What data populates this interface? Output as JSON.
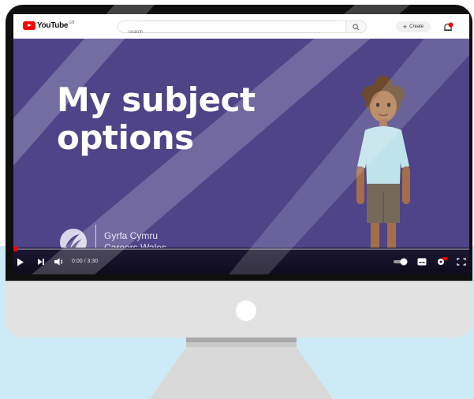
{
  "youtube": {
    "logo_text": "YouTube",
    "region_badge": "GB",
    "search_placeholder": "Search",
    "create_label": "Create"
  },
  "video": {
    "title_line1": "My subject",
    "title_line2": "options",
    "brand_line1": "Gyrfa Cymru",
    "brand_line2": "Careers Wales"
  },
  "player": {
    "current_time": "0:00",
    "duration": "3:30",
    "timecode": "0:00 / 3:30",
    "progress_fraction": 0.01
  },
  "colors": {
    "video_background": "#4e4487",
    "youtube_red": "#ff0000",
    "monitor_body": "#e2e2e2",
    "backdrop": "#cdeaf7"
  }
}
